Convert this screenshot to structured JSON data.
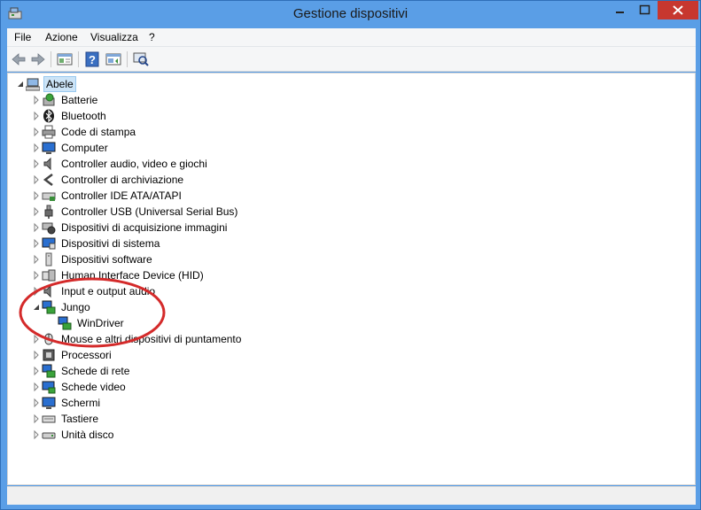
{
  "window": {
    "title": "Gestione dispositivi",
    "app_icon": "device-manager-icon",
    "colors": {
      "frame": "#5a9ee6",
      "close": "#c7372f",
      "selection": "#cce4f7",
      "annotation": "#d42a2a"
    }
  },
  "menu": {
    "items": [
      {
        "label": "File"
      },
      {
        "label": "Azione"
      },
      {
        "label": "Visualizza"
      },
      {
        "label": "?"
      }
    ]
  },
  "toolbar": {
    "buttons": [
      {
        "icon": "back-arrow-icon"
      },
      {
        "icon": "forward-arrow-icon"
      },
      {
        "icon": "properties-pane-icon"
      },
      {
        "icon": "help-icon"
      },
      {
        "icon": "update-driver-icon"
      },
      {
        "icon": "scan-hardware-icon"
      }
    ]
  },
  "tree": {
    "root": {
      "label": "Abele",
      "icon": "computer-icon",
      "expanded": true
    },
    "items": [
      {
        "label": "Batterie",
        "icon": "battery-icon",
        "expanded": false
      },
      {
        "label": "Bluetooth",
        "icon": "bluetooth-icon",
        "expanded": false
      },
      {
        "label": "Code di stampa",
        "icon": "printer-icon",
        "expanded": false
      },
      {
        "label": "Computer",
        "icon": "monitor-icon",
        "expanded": false
      },
      {
        "label": "Controller audio, video e giochi",
        "icon": "speaker-icon",
        "expanded": false
      },
      {
        "label": "Controller di archiviazione",
        "icon": "storage-controller-icon",
        "expanded": false
      },
      {
        "label": "Controller IDE ATA/ATAPI",
        "icon": "ide-controller-icon",
        "expanded": false
      },
      {
        "label": "Controller USB (Universal Serial Bus)",
        "icon": "usb-icon",
        "expanded": false
      },
      {
        "label": "Dispositivi di acquisizione immagini",
        "icon": "camera-icon",
        "expanded": false
      },
      {
        "label": "Dispositivi di sistema",
        "icon": "system-device-icon",
        "expanded": false
      },
      {
        "label": "Dispositivi software",
        "icon": "software-device-icon",
        "expanded": false
      },
      {
        "label": "Human Interface Device (HID)",
        "icon": "hid-icon",
        "expanded": false
      },
      {
        "label": "Input e output audio",
        "icon": "speaker-icon",
        "expanded": false
      },
      {
        "label": "Jungo",
        "icon": "network-device-icon",
        "expanded": true
      },
      {
        "label": "WinDriver",
        "icon": "network-device-icon",
        "child": true
      },
      {
        "label": "Mouse e altri dispositivi di puntamento",
        "icon": "mouse-icon",
        "expanded": false
      },
      {
        "label": "Processori",
        "icon": "processor-icon",
        "expanded": false
      },
      {
        "label": "Schede di rete",
        "icon": "network-card-icon",
        "expanded": false
      },
      {
        "label": "Schede video",
        "icon": "display-adapter-icon",
        "expanded": false
      },
      {
        "label": "Schermi",
        "icon": "monitor-icon",
        "expanded": false
      },
      {
        "label": "Tastiere",
        "icon": "keyboard-icon",
        "expanded": false
      },
      {
        "label": "Unità disco",
        "icon": "disk-drive-icon",
        "expanded": false
      }
    ]
  }
}
